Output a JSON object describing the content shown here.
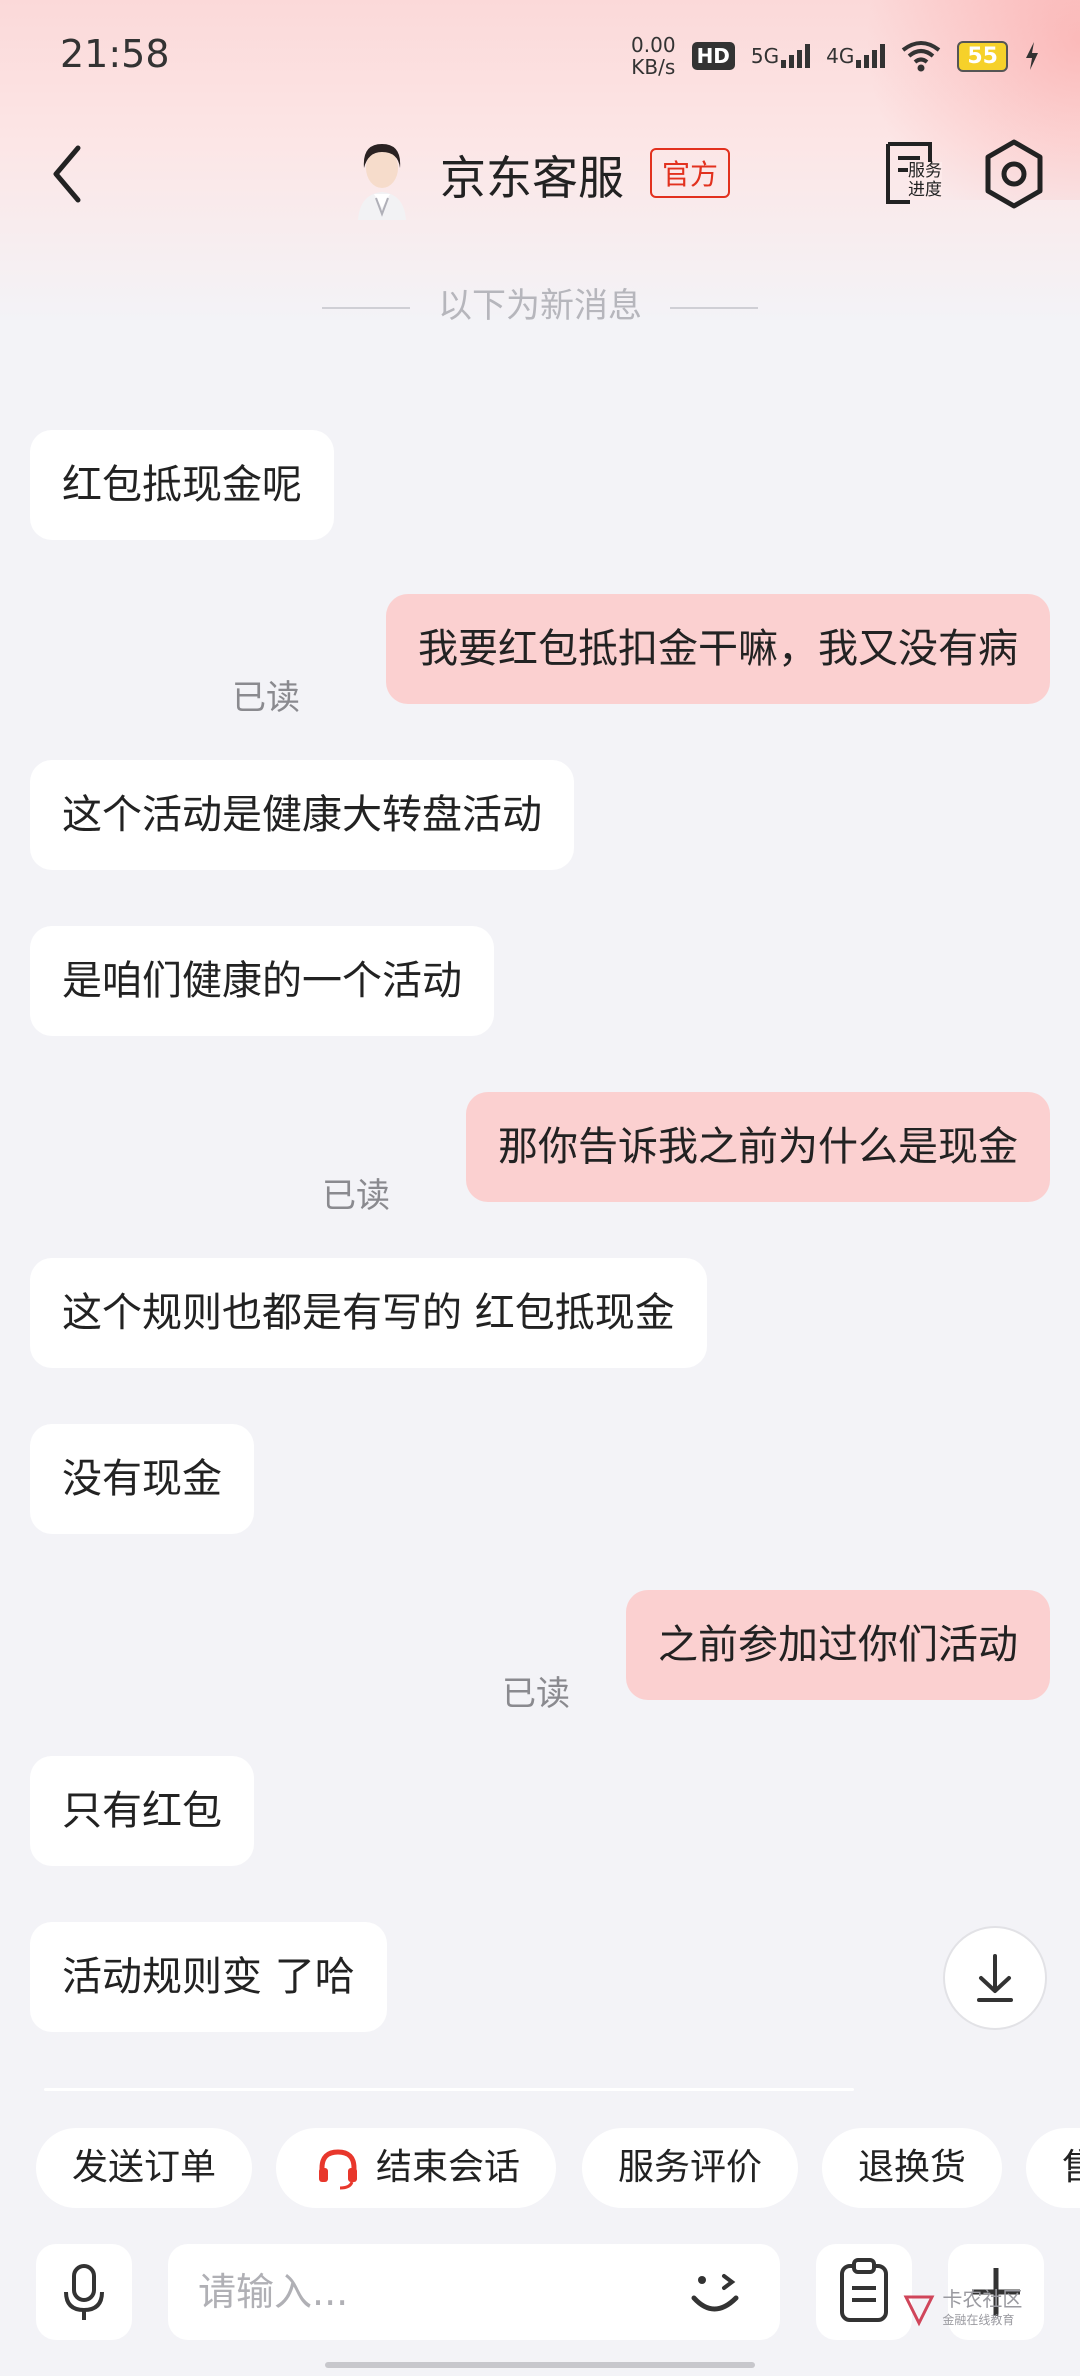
{
  "status_bar": {
    "time": "21:58",
    "net_speed": "0.00",
    "net_unit": "KB/s",
    "hd": "HD",
    "sig1": "5G",
    "sig2": "4G",
    "battery": "55"
  },
  "header": {
    "title": "京东客服",
    "badge": "官方",
    "service_progress": "服务\n进度"
  },
  "divider_text": "以下为新消息",
  "messages": [
    {
      "side": "left",
      "text": "红包抵现金呢"
    },
    {
      "side": "right",
      "text": "我要红包抵扣金干嘛，我又没有病",
      "status": "已读"
    },
    {
      "side": "left",
      "text": "这个活动是健康大转盘活动"
    },
    {
      "side": "left",
      "text": "是咱们健康的一个活动"
    },
    {
      "side": "right",
      "text": "那你告诉我之前为什么是现金",
      "status": "已读"
    },
    {
      "side": "left",
      "text": "这个规则也都是有写的 红包抵现金"
    },
    {
      "side": "left",
      "text": "没有现金"
    },
    {
      "side": "right",
      "text": "之前参加过你们活动",
      "status": "已读"
    },
    {
      "side": "left",
      "text": "只有红包"
    },
    {
      "side": "left",
      "text": "活动规则变 了哈"
    }
  ],
  "quick_actions": [
    "发送订单",
    "结束会话",
    "服务评价",
    "退换货",
    "售"
  ],
  "input": {
    "placeholder": "请输入..."
  },
  "watermark": {
    "line1": "卡农社区",
    "line2": "金融在线教育"
  },
  "colors": {
    "accent": "#e2311e",
    "right_bubble": "#fbd0d0",
    "headset": "#e8372c"
  }
}
